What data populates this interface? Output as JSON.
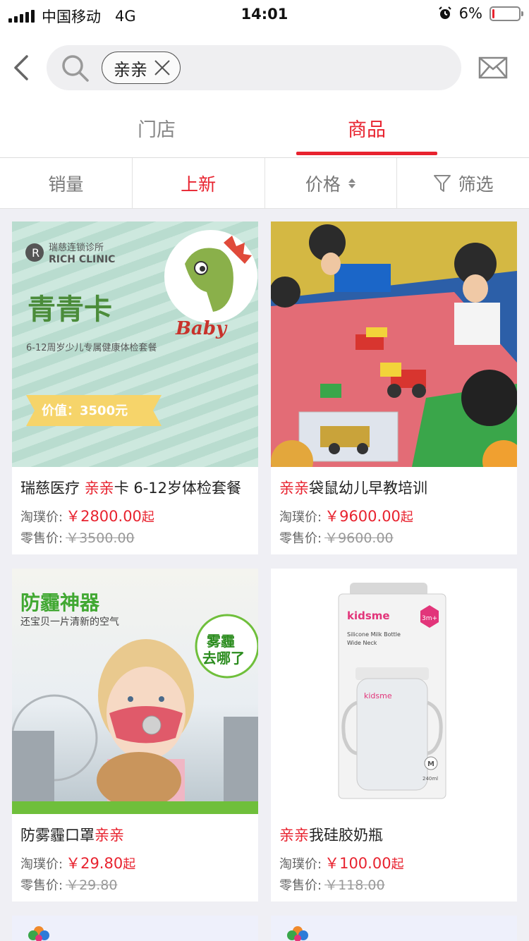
{
  "status_bar": {
    "carrier": "中国移动",
    "network": "4G",
    "time": "14:01",
    "battery_percent": "6%",
    "battery_level": 0.06
  },
  "search": {
    "query": "亲亲"
  },
  "tabs": [
    {
      "label": "门店",
      "active": false
    },
    {
      "label": "商品",
      "active": true
    }
  ],
  "sort_options": [
    {
      "label": "销量",
      "active": false
    },
    {
      "label": "上新",
      "active": true
    },
    {
      "label": "价格",
      "active": false
    },
    {
      "label": "筛选",
      "active": false
    }
  ],
  "products": [
    {
      "name_before": "瑞慈医疗 ",
      "name_highlight": "亲亲",
      "name_after": "卡 6-12岁体检套餐",
      "price_label": "淘璞价:",
      "price": "￥2800.00",
      "price_suffix": "起",
      "retail_label": "零售价:",
      "retail_price": "￥3500.00",
      "image_text": {
        "clinic_cn": "瑞慈连锁诊所",
        "clinic_en": "RICH CLINIC",
        "card_title": "青青卡",
        "subtitle": "6-12周岁少儿专属健康体检套餐",
        "value_tag": "价值：3500元",
        "baby": "Baby"
      }
    },
    {
      "name_before": "",
      "name_highlight": "亲亲",
      "name_after": "袋鼠幼儿早教培训",
      "price_label": "淘璞价:",
      "price": "￥9600.00",
      "price_suffix": "起",
      "retail_label": "零售价:",
      "retail_price": "￥9600.00"
    },
    {
      "name_before": "防雾霾口罩",
      "name_highlight": "亲亲",
      "name_after": "",
      "price_label": "淘璞价:",
      "price": "￥29.80",
      "price_suffix": "起",
      "retail_label": "零售价:",
      "retail_price": "￥29.80",
      "image_text": {
        "headline": "防霾神器",
        "subline": "还宝贝一片清新的空气",
        "badge_line1": "雾霾",
        "badge_line2": "去哪了"
      }
    },
    {
      "name_before": "",
      "name_highlight": "亲亲",
      "name_after": "我硅胶奶瓶",
      "price_label": "淘璞价:",
      "price": "￥100.00",
      "price_suffix": "起",
      "retail_label": "零售价:",
      "retail_price": "￥118.00",
      "image_text": {
        "brand": "kidsme",
        "line1": "Silicone Milk Bottle",
        "line2": "Wide Neck",
        "age": "3m+",
        "size_mark": "M",
        "volume": "240ml"
      }
    }
  ],
  "colors": {
    "accent": "#e8232f",
    "background": "#efeff4"
  }
}
